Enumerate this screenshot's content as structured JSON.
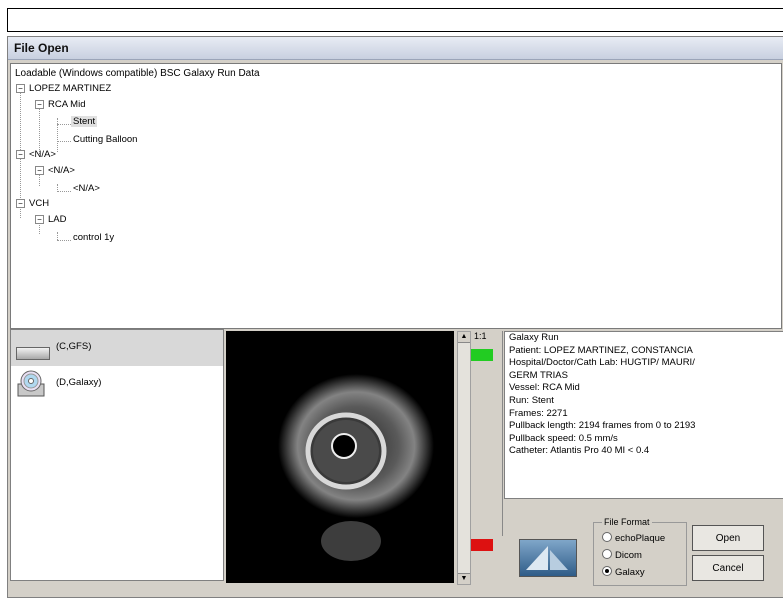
{
  "window": {
    "title": "File Open"
  },
  "tree": {
    "root_label": "Loadable (Windows compatible) BSC Galaxy Run Data",
    "nodes": [
      {
        "label": "LOPEZ MARTINEZ",
        "level": 1
      },
      {
        "label": "RCA Mid",
        "level": 2
      },
      {
        "label": "Stent",
        "level": 3,
        "selected": true
      },
      {
        "label": "Cutting Balloon",
        "level": 3
      },
      {
        "label": "<N/A>",
        "level": 1
      },
      {
        "label": "<N/A>",
        "level": 2
      },
      {
        "label": "<N/A>",
        "level": 3
      },
      {
        "label": "VCH",
        "level": 1
      },
      {
        "label": "LAD",
        "level": 2
      },
      {
        "label": "control 1y",
        "level": 3
      }
    ]
  },
  "drives": [
    {
      "label": "(C,GFS)",
      "icon": "hard-drive-icon"
    },
    {
      "label": "(D,Galaxy)",
      "icon": "cd-drive-icon"
    }
  ],
  "viewer": {
    "ratio_label": "1:1"
  },
  "info": {
    "lines": [
      "Galaxy Run",
      "Patient: LOPEZ MARTINEZ, CONSTANCIA",
      "Hospital/Doctor/Cath Lab: HUGTIP/ MAURI/",
      "GERM TRIAS",
      "Vessel: RCA Mid",
      "Run: Stent",
      "Frames: 2271",
      "Pullback length:  2194 frames from 0 to 2193",
      "Pullback speed: 0.5 mm/s",
      "Catheter: Atlantis Pro 40 MI < 0.4"
    ]
  },
  "file_format": {
    "legend": "File Format",
    "options": [
      "echoPlaque",
      "Dicom",
      "Galaxy"
    ],
    "selected": "Galaxy"
  },
  "buttons": {
    "open": "Open",
    "cancel": "Cancel"
  }
}
